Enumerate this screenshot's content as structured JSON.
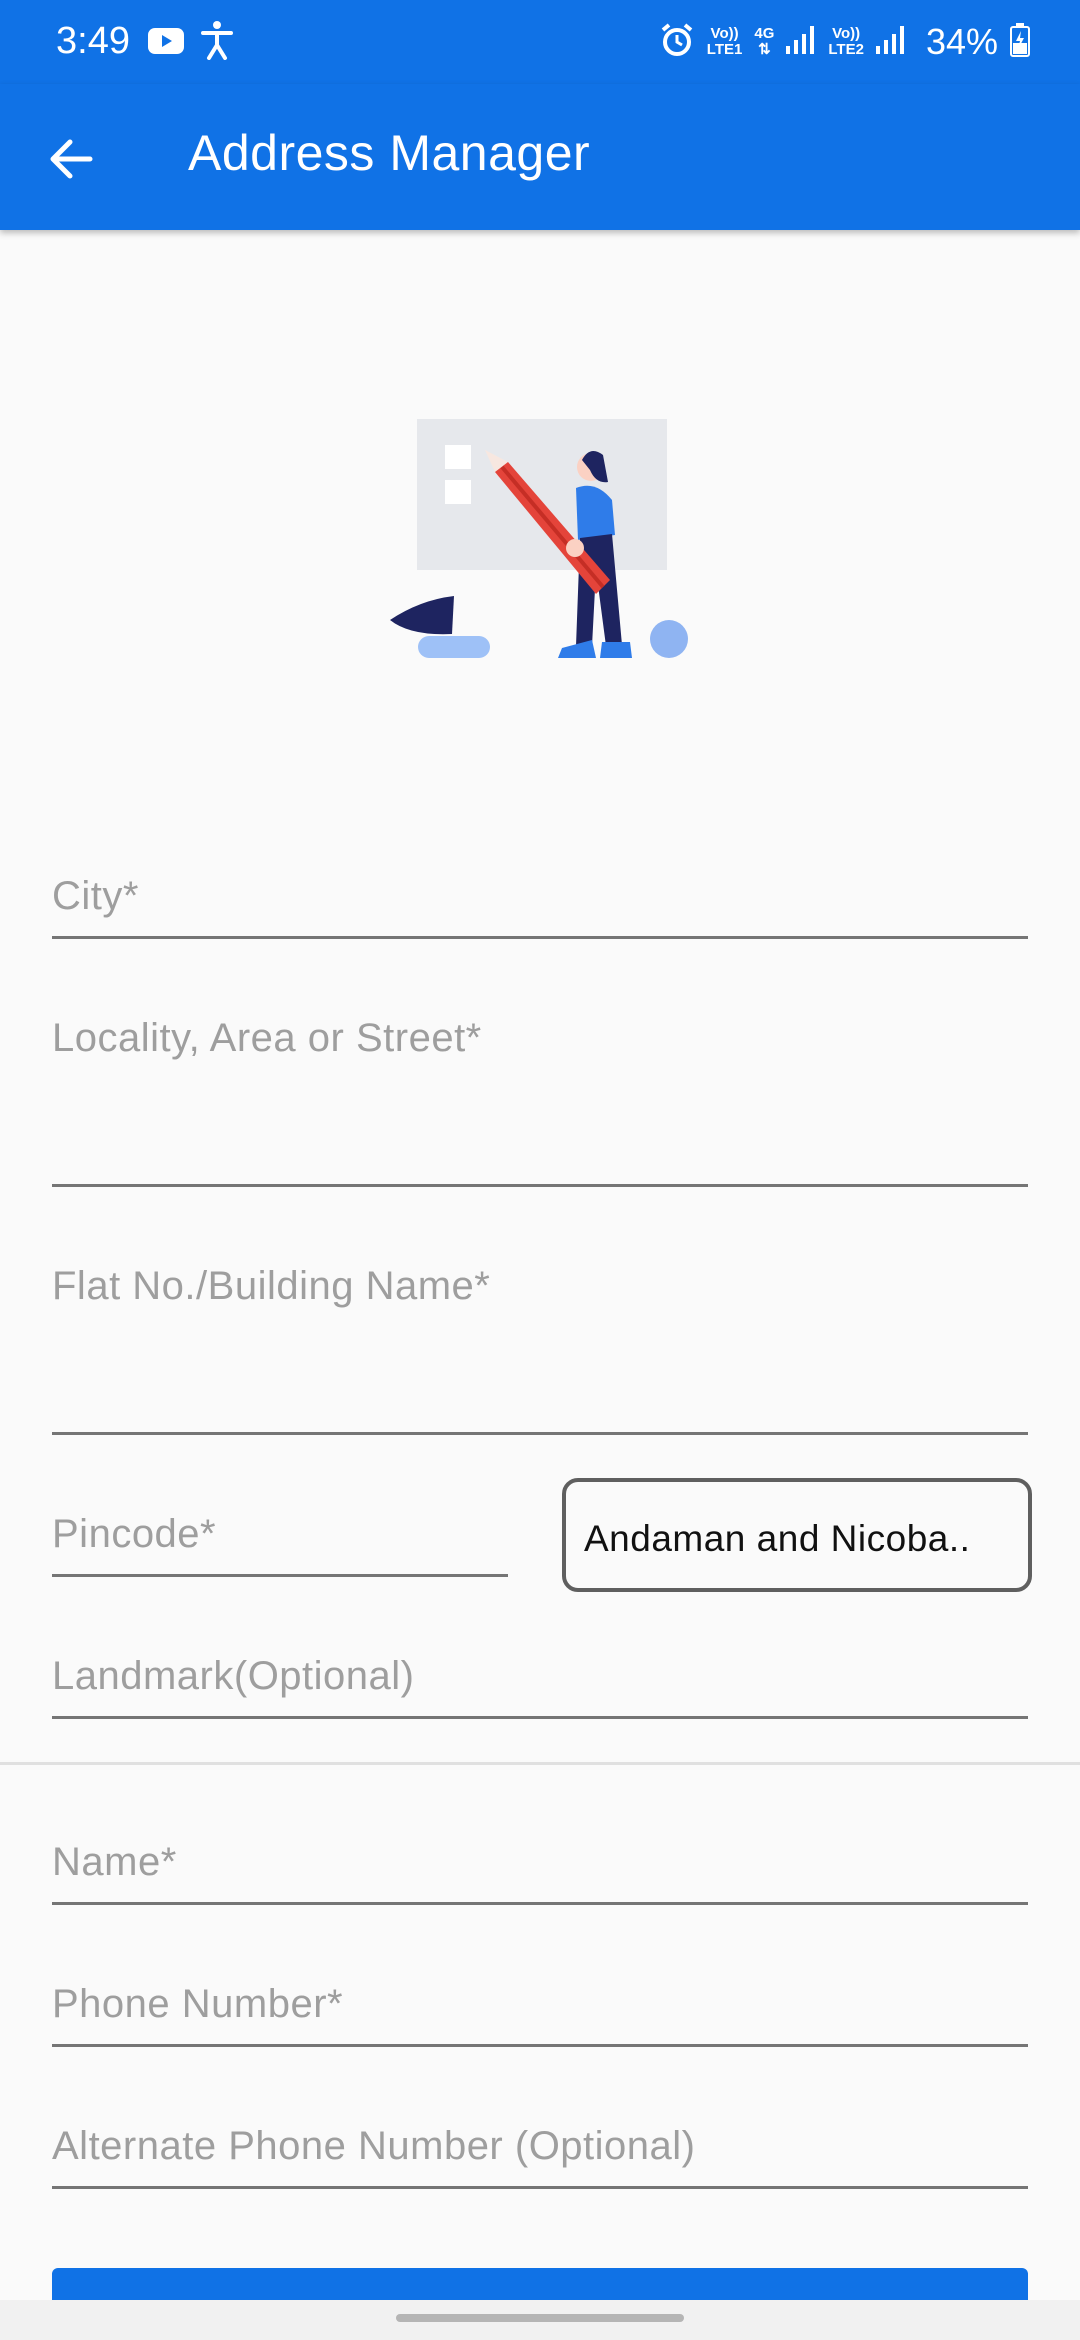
{
  "status_bar": {
    "time": "3:49",
    "net1_top": "Vo))",
    "net1_bottom": "LTE1",
    "net_type": "4G",
    "net2_top": "Vo))",
    "net2_bottom": "LTE2",
    "battery": "34%",
    "icons": [
      "youtube-icon",
      "accessibility-icon",
      "alarm-icon",
      "signal-icon",
      "battery-icon"
    ]
  },
  "app_bar": {
    "title": "Address Manager",
    "back_icon": "arrow-left-icon"
  },
  "form": {
    "city_label": "City*",
    "locality_label": "Locality, Area or Street*",
    "flat_label": "Flat No./Building Name*",
    "pincode_label": "Pincode*",
    "state_value": "Andaman and Nicoba..",
    "landmark_label": "Landmark(Optional)",
    "name_label": "Name*",
    "phone_label": "Phone Number*",
    "alt_phone_label": "Alternate Phone Number (Optional)"
  },
  "colors": {
    "primary": "#1072e6",
    "background": "#fafafa",
    "hint_text": "#9e9e9e"
  }
}
